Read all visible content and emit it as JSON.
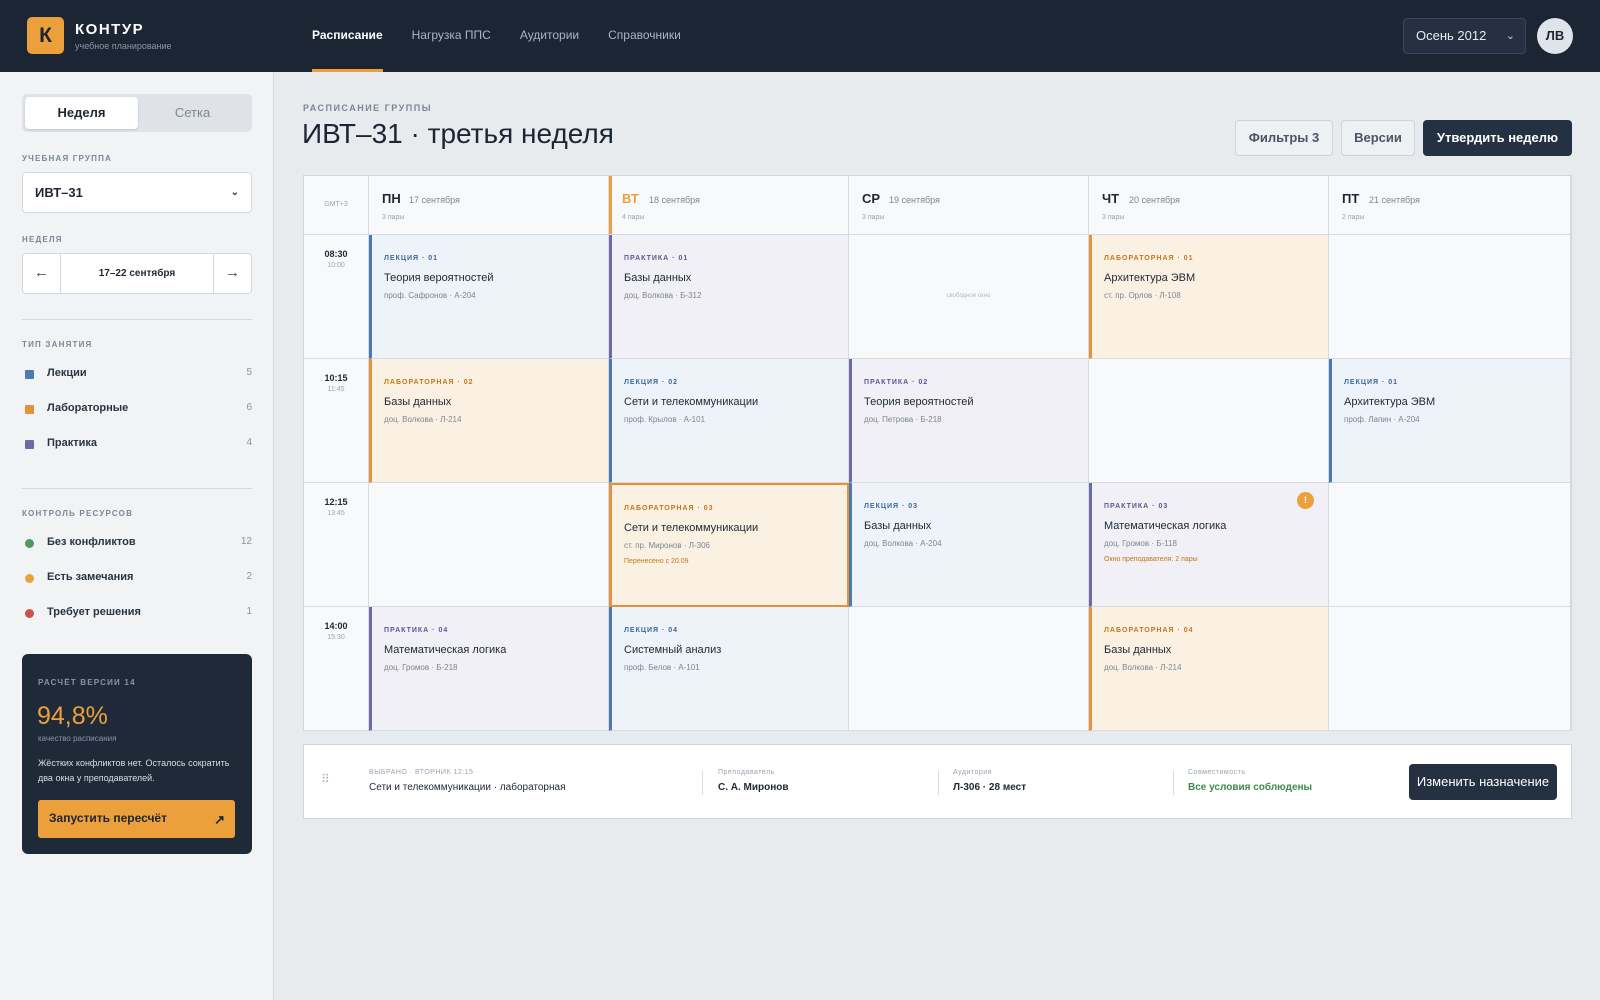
{
  "app": {
    "logo_letter": "К",
    "name": "КОНТУР",
    "subtitle": "учебное планирование",
    "nav": [
      {
        "label": "Расписание",
        "active": true
      },
      {
        "label": "Нагрузка ППС",
        "active": false
      },
      {
        "label": "Аудитории",
        "active": false
      },
      {
        "label": "Справочники",
        "active": false
      }
    ],
    "season": "Осень 2012",
    "avatar_initials": "ЛВ"
  },
  "sidebar": {
    "view_toggle": {
      "week": "Неделя",
      "grid": "Сетка",
      "selected": "Неделя"
    },
    "group_label": "УЧЕБНАЯ ГРУППА",
    "group_value": "ИВТ–31",
    "week_label": "НЕДЕЛЯ",
    "week_value": "17–22 сентября",
    "type_label": "ТИП ЗАНЯТИЯ",
    "types": [
      {
        "label": "Лекции",
        "count": "5",
        "color": "#4d7ab3"
      },
      {
        "label": "Лабораторные",
        "count": "6",
        "color": "#e3923a"
      },
      {
        "label": "Практика",
        "count": "4",
        "color": "#6e6aa8"
      }
    ],
    "resources_label": "КОНТРОЛЬ РЕСУРСОВ",
    "resources": [
      {
        "label": "Без конфликтов",
        "count": "12",
        "color": "#4f9a62"
      },
      {
        "label": "Есть замечания",
        "count": "2",
        "color": "#eba03c"
      },
      {
        "label": "Требует решения",
        "count": "1",
        "color": "#c9534a"
      }
    ],
    "calc": {
      "title": "РАСЧЁТ ВЕРСИИ 14",
      "percent": "94,8%",
      "percent_label": "качество расписания",
      "text": "Жёстких конфликтов нет. Осталось сократить два окна у преподавателей.",
      "button": "Запустить пересчёт"
    }
  },
  "header": {
    "eyebrow": "РАСПИСАНИЕ ГРУППЫ",
    "title": "ИВТ–31 · третья неделя",
    "filters_button": "Фильтры 3",
    "versions_button": "Версии",
    "approve_button": "Утвердить неделю"
  },
  "schedule": {
    "timezone": "GMT+3",
    "free_slot_text": "свободное окно",
    "days": [
      {
        "abbr": "ПН",
        "date": "17 сентября",
        "count": "3 пары",
        "today": false
      },
      {
        "abbr": "ВТ",
        "date": "18 сентября",
        "count": "4 пары",
        "today": true
      },
      {
        "abbr": "СР",
        "date": "19 сентября",
        "count": "3 пары",
        "today": false
      },
      {
        "abbr": "ЧТ",
        "date": "20 сентября",
        "count": "3 пары",
        "today": false
      },
      {
        "abbr": "ПТ",
        "date": "21 сентября",
        "count": "2 пары",
        "today": false
      }
    ],
    "slots": [
      {
        "start": "08:30",
        "end": "10:00"
      },
      {
        "start": "10:15",
        "end": "11:45"
      },
      {
        "start": "12:15",
        "end": "13:45"
      },
      {
        "start": "14:00",
        "end": "15:30"
      }
    ],
    "cells": [
      [
        {
          "kind": "lec",
          "type": "ЛЕКЦИЯ · 01",
          "title": "Теория вероятностей",
          "meta": "проф. Сафронов · А-204"
        },
        {
          "kind": "pr",
          "type": "ПРАКТИКА · 01",
          "title": "Базы данных",
          "meta": "доц. Волкова · Б-312"
        },
        {
          "kind": "free"
        },
        {
          "kind": "lab",
          "type": "ЛАБОРАТОРНАЯ · 01",
          "title": "Архитектура ЭВМ",
          "meta": "ст. пр. Орлов · Л-108"
        },
        {
          "kind": "empty"
        }
      ],
      [
        {
          "kind": "lab",
          "type": "ЛАБОРАТОРНАЯ · 02",
          "title": "Базы данных",
          "meta": "доц. Волкова · Л-214"
        },
        {
          "kind": "lec",
          "type": "ЛЕКЦИЯ · 02",
          "title": "Сети и телекоммуникации",
          "meta": "проф. Крылов · А-101"
        },
        {
          "kind": "pr",
          "type": "ПРАКТИКА · 02",
          "title": "Теория вероятностей",
          "meta": "доц. Петрова · Б-218"
        },
        {
          "kind": "empty"
        },
        {
          "kind": "lec",
          "type": "ЛЕКЦИЯ · 01",
          "title": "Архитектура ЭВМ",
          "meta": "проф. Лапин · А-204"
        }
      ],
      [
        {
          "kind": "empty"
        },
        {
          "kind": "lab",
          "selected": true,
          "type": "ЛАБОРАТОРНАЯ · 03",
          "title": "Сети и телекоммуникации",
          "meta": "ст. пр. Миронов · Л-306",
          "note": "Перенесено с 20.09"
        },
        {
          "kind": "lec",
          "type": "ЛЕКЦИЯ · 03",
          "title": "Базы данных",
          "meta": "доц. Волкова · А-204"
        },
        {
          "kind": "pr",
          "type": "ПРАКТИКА · 03",
          "title": "Математическая логика",
          "meta": "доц. Громов · Б-118",
          "note": "Окно преподавателя: 2 пары",
          "warning": "!"
        },
        {
          "kind": "empty"
        }
      ],
      [
        {
          "kind": "pr",
          "type": "ПРАКТИКА · 04",
          "title": "Математическая логика",
          "meta": "доц. Громов · Б-218"
        },
        {
          "kind": "lec",
          "type": "ЛЕКЦИЯ · 04",
          "title": "Системный анализ",
          "meta": "проф. Белов · А-101"
        },
        {
          "kind": "empty"
        },
        {
          "kind": "lab",
          "type": "ЛАБОРАТОРНАЯ · 04",
          "title": "Базы данных",
          "meta": "доц. Волкова · Л-214"
        },
        {
          "kind": "empty"
        }
      ]
    ]
  },
  "selection": {
    "label": "ВЫБРАНО · ВТОРНИК 12:15",
    "value": "Сети и телекоммуникации · лабораторная",
    "teacher_label": "Преподаватель",
    "teacher": "С. А. Миронов",
    "room_label": "Аудитория",
    "room": "Л-306 · 28 мест",
    "compat_label": "Совместимость",
    "compat": "Все условия соблюдены",
    "button": "Изменить назначение"
  }
}
